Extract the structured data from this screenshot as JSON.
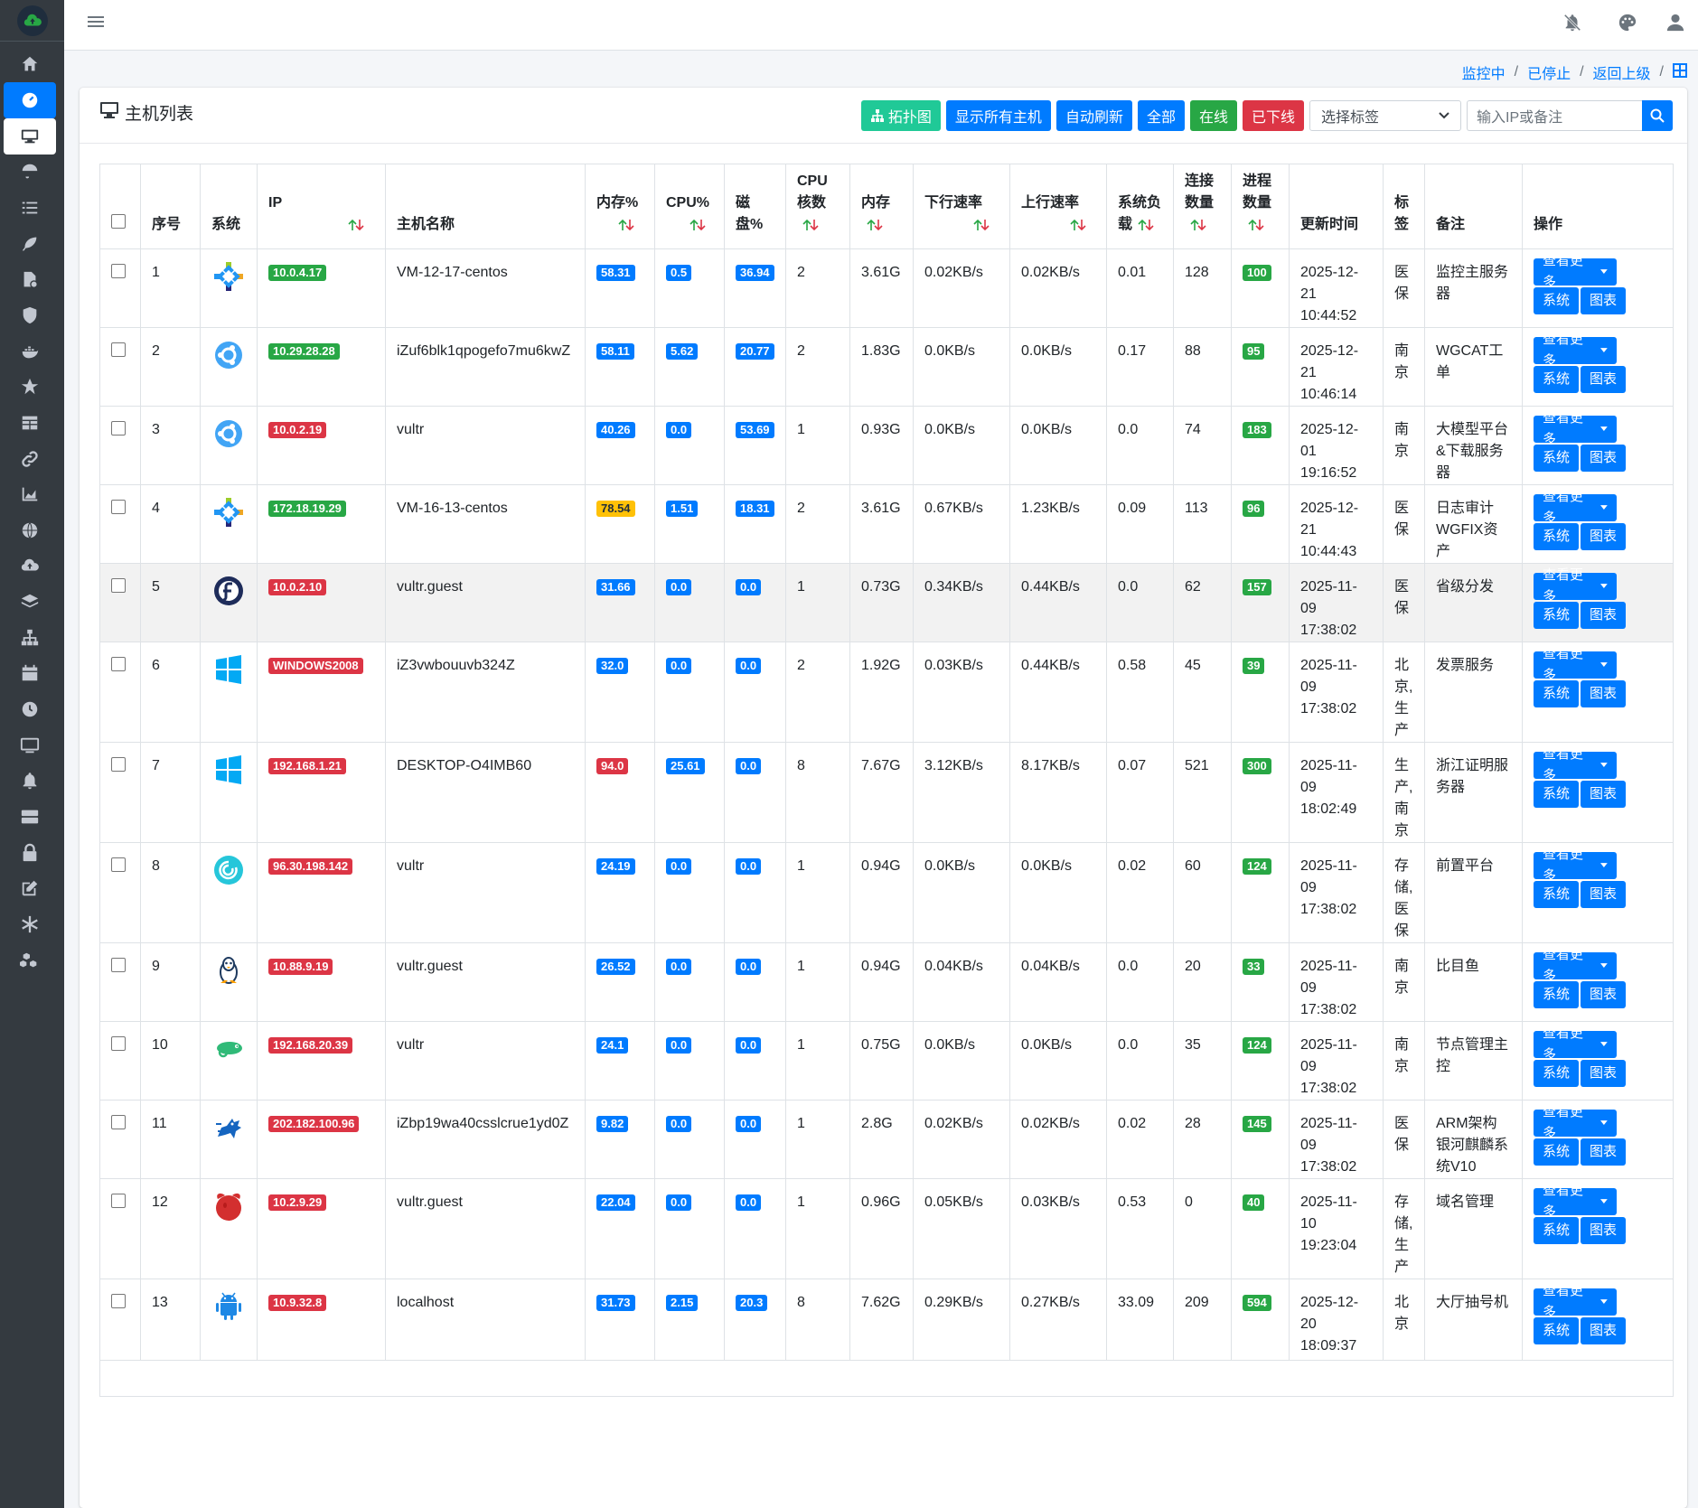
{
  "card": {
    "title": "主机列表"
  },
  "toolbar": {
    "topology": "拓扑图",
    "show_all": "显示所有主机",
    "auto_refresh": "自动刷新",
    "all": "全部",
    "online": "在线",
    "offline": "已下线",
    "tag_select": "选择标签",
    "search_placeholder": "输入IP或备注"
  },
  "breadcrumb": {
    "monitoring": "监控中",
    "stopped": "已停止",
    "back": "返回上级"
  },
  "table": {
    "headers": {
      "no": "序号",
      "os": "系统",
      "ip": "IP",
      "hostname": "主机名称",
      "mem_pct": "内存%",
      "cpu_pct": "CPU%",
      "disk_pct": "磁盘%",
      "cpu_cores": "CPU核数",
      "mem": "内存",
      "down": "下行速率",
      "up": "上行速率",
      "load": "系统负载",
      "conn": "连接数量",
      "proc": "进程数量",
      "updated": "更新时间",
      "tag": "标签",
      "remark": "备注",
      "ops": "操作"
    },
    "actions": {
      "more": "查看更多",
      "system": "系统",
      "chart": "图表"
    },
    "rows": [
      {
        "no": "1",
        "os": "centos",
        "ip": "10.0.4.17",
        "ip_color": "success",
        "host": "VM-12-17-centos",
        "mem": "58.31",
        "mem_color": "primary",
        "cpu": "0.5",
        "disk": "36.94",
        "cores": "2",
        "memsize": "3.61G",
        "down": "0.02KB/s",
        "up": "0.02KB/s",
        "load": "0.01",
        "conn": "128",
        "proc": "100",
        "updated": [
          "2025-12-",
          "21",
          "10:44:52"
        ],
        "tag": [
          "医",
          "保"
        ],
        "remark": [
          "监控主服务",
          "器"
        ]
      },
      {
        "no": "2",
        "os": "ubuntu",
        "ip": "10.29.28.28",
        "ip_color": "success",
        "host": "iZuf6blk1qpogefo7mu6kwZ",
        "mem": "58.11",
        "mem_color": "primary",
        "cpu": "5.62",
        "disk": "20.77",
        "cores": "2",
        "memsize": "1.83G",
        "down": "0.0KB/s",
        "up": "0.0KB/s",
        "load": "0.17",
        "conn": "88",
        "proc": "95",
        "updated": [
          "2025-12-",
          "21",
          "10:46:14"
        ],
        "tag": [
          "南",
          "京"
        ],
        "remark": [
          "WGCAT工",
          "单"
        ]
      },
      {
        "no": "3",
        "os": "ubuntu",
        "ip": "10.0.2.19",
        "ip_color": "danger",
        "host": "vultr",
        "mem": "40.26",
        "mem_color": "primary",
        "cpu": "0.0",
        "disk": "53.69",
        "cores": "1",
        "memsize": "0.93G",
        "down": "0.0KB/s",
        "up": "0.0KB/s",
        "load": "0.0",
        "conn": "74",
        "proc": "183",
        "updated": [
          "2025-12-",
          "01",
          "19:16:52"
        ],
        "tag": [
          "南",
          "京"
        ],
        "remark": [
          "大模型平台",
          "&下载服务",
          "器"
        ]
      },
      {
        "no": "4",
        "os": "centos",
        "ip": "172.18.19.29",
        "ip_color": "success",
        "host": "VM-16-13-centos",
        "mem": "78.54",
        "mem_color": "warning",
        "cpu": "1.51",
        "disk": "18.31",
        "cores": "2",
        "memsize": "3.61G",
        "down": "0.67KB/s",
        "up": "1.23KB/s",
        "load": "0.09",
        "conn": "113",
        "proc": "96",
        "updated": [
          "2025-12-",
          "21",
          "10:44:43"
        ],
        "tag": [
          "医",
          "保"
        ],
        "remark": [
          "日志审计",
          "WGFIX资产"
        ]
      },
      {
        "no": "5",
        "os": "fedora",
        "ip": "10.0.2.10",
        "ip_color": "danger",
        "host": "vultr.guest",
        "mem": "31.66",
        "mem_color": "primary",
        "cpu": "0.0",
        "disk": "0.0",
        "cores": "1",
        "memsize": "0.73G",
        "down": "0.34KB/s",
        "up": "0.44KB/s",
        "load": "0.0",
        "conn": "62",
        "proc": "157",
        "updated": [
          "2025-11-",
          "09",
          "17:38:02"
        ],
        "tag": [
          "医",
          "保"
        ],
        "remark": [
          "省级分发"
        ]
      },
      {
        "no": "6",
        "os": "windows",
        "ip": "WINDOWS2008",
        "ip_color": "danger",
        "host": "iZ3vwbouuvb324Z",
        "mem": "32.0",
        "mem_color": "primary",
        "cpu": "0.0",
        "disk": "0.0",
        "cores": "2",
        "memsize": "1.92G",
        "down": "0.03KB/s",
        "up": "0.44KB/s",
        "load": "0.58",
        "conn": "45",
        "proc": "39",
        "updated": [
          "2025-11-",
          "09",
          "17:38:02"
        ],
        "tag": [
          "北",
          "京,",
          "生",
          "产"
        ],
        "remark": [
          "发票服务"
        ]
      },
      {
        "no": "7",
        "os": "windows",
        "ip": "192.168.1.21",
        "ip_color": "danger",
        "host": "DESKTOP-O4IMB60",
        "mem": "94.0",
        "mem_color": "danger",
        "cpu": "25.61",
        "disk": "0.0",
        "cores": "8",
        "memsize": "7.67G",
        "down": "3.12KB/s",
        "up": "8.17KB/s",
        "load": "0.07",
        "conn": "521",
        "proc": "300",
        "updated": [
          "2025-11-",
          "09",
          "18:02:49"
        ],
        "tag": [
          "生",
          "产,",
          "南",
          "京"
        ],
        "remark": [
          "浙江证明服",
          "务器"
        ]
      },
      {
        "no": "8",
        "os": "debian",
        "ip": "96.30.198.142",
        "ip_color": "danger",
        "host": "vultr",
        "mem": "24.19",
        "mem_color": "primary",
        "cpu": "0.0",
        "disk": "0.0",
        "cores": "1",
        "memsize": "0.94G",
        "down": "0.0KB/s",
        "up": "0.0KB/s",
        "load": "0.02",
        "conn": "60",
        "proc": "124",
        "updated": [
          "2025-11-",
          "09",
          "17:38:02"
        ],
        "tag": [
          "存",
          "储,",
          "医",
          "保"
        ],
        "remark": [
          "前置平台"
        ]
      },
      {
        "no": "9",
        "os": "linux",
        "ip": "10.88.9.19",
        "ip_color": "danger",
        "host": "vultr.guest",
        "mem": "26.52",
        "mem_color": "primary",
        "cpu": "0.0",
        "disk": "0.0",
        "cores": "1",
        "memsize": "0.94G",
        "down": "0.04KB/s",
        "up": "0.04KB/s",
        "load": "0.0",
        "conn": "20",
        "proc": "33",
        "updated": [
          "2025-11-",
          "09",
          "17:38:02"
        ],
        "tag": [
          "南",
          "京"
        ],
        "remark": [
          "比目鱼"
        ]
      },
      {
        "no": "10",
        "os": "opensuse",
        "ip": "192.168.20.39",
        "ip_color": "danger",
        "host": "vultr",
        "mem": "24.1",
        "mem_color": "primary",
        "cpu": "0.0",
        "disk": "0.0",
        "cores": "1",
        "memsize": "0.75G",
        "down": "0.0KB/s",
        "up": "0.0KB/s",
        "load": "0.0",
        "conn": "35",
        "proc": "124",
        "updated": [
          "2025-11-",
          "09",
          "17:38:02"
        ],
        "tag": [
          "南",
          "京"
        ],
        "remark": [
          "节点管理主",
          "控"
        ]
      },
      {
        "no": "11",
        "os": "kylin",
        "ip": "202.182.100.96",
        "ip_color": "danger",
        "host": "iZbp19wa40csslcrue1yd0Z",
        "mem": "9.82",
        "mem_color": "primary",
        "cpu": "0.0",
        "disk": "0.0",
        "cores": "1",
        "memsize": "2.8G",
        "down": "0.02KB/s",
        "up": "0.02KB/s",
        "load": "0.02",
        "conn": "28",
        "proc": "145",
        "updated": [
          "2025-11-",
          "09",
          "17:38:02"
        ],
        "tag": [
          "医",
          "保"
        ],
        "remark": [
          "ARM架构",
          "银河麒麟系",
          "统V10"
        ]
      },
      {
        "no": "12",
        "os": "freebsd",
        "ip": "10.2.9.29",
        "ip_color": "danger",
        "host": "vultr.guest",
        "mem": "22.04",
        "mem_color": "primary",
        "cpu": "0.0",
        "disk": "0.0",
        "cores": "1",
        "memsize": "0.96G",
        "down": "0.05KB/s",
        "up": "0.03KB/s",
        "load": "0.53",
        "conn": "0",
        "proc": "40",
        "updated": [
          "2025-11-",
          "10",
          "19:23:04"
        ],
        "tag": [
          "存",
          "储,",
          "生",
          "产"
        ],
        "remark": [
          "域名管理"
        ]
      },
      {
        "no": "13",
        "os": "android",
        "ip": "10.9.32.8",
        "ip_color": "danger",
        "host": "localhost",
        "mem": "31.73",
        "mem_color": "primary",
        "cpu": "2.15",
        "disk": "20.3",
        "cores": "8",
        "memsize": "7.62G",
        "down": "0.29KB/s",
        "up": "0.27KB/s",
        "load": "33.09",
        "conn": "209",
        "proc": "594",
        "updated": [
          "2025-12-",
          "20",
          "18:09:37"
        ],
        "tag": [
          "北",
          "京"
        ],
        "remark": [
          "大厅抽号机"
        ]
      }
    ]
  }
}
